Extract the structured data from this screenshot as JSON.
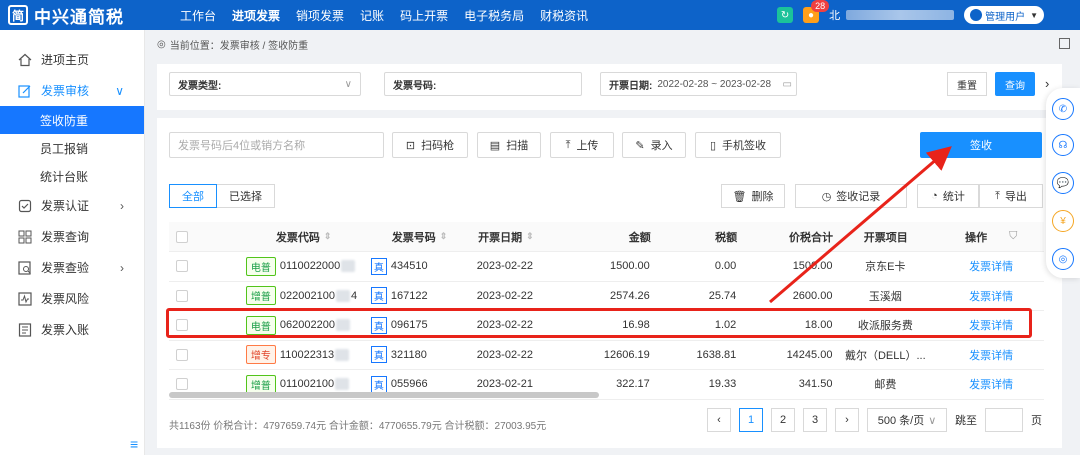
{
  "app": {
    "logo_mark": "简",
    "name": "中兴通简税"
  },
  "topnav": [
    {
      "label": "工作台"
    },
    {
      "label": "进项发票",
      "active": true
    },
    {
      "label": "销项发票"
    },
    {
      "label": "记账"
    },
    {
      "label": "码上开票"
    },
    {
      "label": "电子税务局"
    },
    {
      "label": "财税资讯"
    }
  ],
  "topbar": {
    "notif_count": "28",
    "city": "北",
    "user": "管理用户"
  },
  "sidebar": {
    "items": [
      {
        "label": "进项主页",
        "icon": "home-icon"
      },
      {
        "label": "发票审核",
        "icon": "edit-icon",
        "expanded": true
      },
      {
        "label": "签收防重",
        "sub": true,
        "active": true
      },
      {
        "label": "员工报销",
        "sub": true
      },
      {
        "label": "统计台账",
        "sub": true
      },
      {
        "label": "发票认证",
        "icon": "verify-icon",
        "arrow": true
      },
      {
        "label": "发票查询",
        "icon": "grid-icon"
      },
      {
        "label": "发票查验",
        "icon": "inspect-icon",
        "arrow": true
      },
      {
        "label": "发票风险",
        "icon": "risk-icon"
      },
      {
        "label": "发票入账",
        "icon": "ledger-icon"
      }
    ]
  },
  "breadcrumb": "当前位置：发票审核 / 签收防重",
  "filters": {
    "type_label": "发票类型:",
    "number_label": "发票号码:",
    "date_label": "开票日期:",
    "date_value": "2022-02-28 ~ 2023-02-28",
    "reset": "重置",
    "query": "查询",
    "more": "›"
  },
  "toolbar": {
    "search_placeholder": "发票号码后4位或销方名称",
    "scan_gun": "扫码枪",
    "scan": "扫描",
    "upload": "上传",
    "entry": "录入",
    "mobile_sign": "手机签收",
    "sign": "签收"
  },
  "segments": {
    "all": "全部",
    "selected": "已选择"
  },
  "actions": {
    "delete": "删除",
    "sign_record": "签收记录",
    "stats": "统计",
    "export": "导出"
  },
  "table": {
    "headers": {
      "code": "发票代码",
      "number": "发票号码",
      "date": "开票日期",
      "amount": "金额",
      "tax": "税额",
      "total": "价税合计",
      "item": "开票项目",
      "op": "操作"
    },
    "rows": [
      {
        "tag": "电普",
        "tag_color": "green",
        "code": "0110022000",
        "code_tail": "",
        "num": "434510",
        "date": "2023-02-22",
        "amount": "1500.00",
        "tax": "0.00",
        "total": "1500.00",
        "item": "京东E卡",
        "op": "发票详情"
      },
      {
        "tag": "增普",
        "tag_color": "green",
        "code": "022002100",
        "code_tail": "4",
        "num": "167122",
        "date": "2023-02-22",
        "amount": "2574.26",
        "tax": "25.74",
        "total": "2600.00",
        "item": "玉溪烟",
        "op": "发票详情"
      },
      {
        "tag": "电普",
        "tag_color": "green",
        "code": "062002200",
        "code_tail": "",
        "num": "096175",
        "date": "2023-02-22",
        "amount": "16.98",
        "tax": "1.02",
        "total": "18.00",
        "item": "收派服务费",
        "op": "发票详情"
      },
      {
        "tag": "增专",
        "tag_color": "red",
        "code": "110022313",
        "code_tail": "",
        "num": "321180",
        "date": "2023-02-22",
        "amount": "12606.19",
        "tax": "1638.81",
        "total": "14245.00",
        "item": "戴尔（DELL）...",
        "op": "发票详情"
      },
      {
        "tag": "增普",
        "tag_color": "green",
        "code": "011002100",
        "code_tail": "",
        "num": "055966",
        "date": "2023-02-21",
        "amount": "322.17",
        "tax": "19.33",
        "total": "341.50",
        "item": "邮费",
        "op": "发票详情"
      }
    ],
    "type_tag": "真"
  },
  "footer": {
    "summary": "共1163份 价税合计：4797659.74元 合计金额：4770655.79元 合计税额：27003.95元",
    "pages": [
      "1",
      "2",
      "3"
    ],
    "page_size": "500 条/页",
    "jump": "跳至",
    "page_unit": "页"
  },
  "colors": {
    "brand": "#0d63c9",
    "accent": "#1890ff",
    "highlight": "#e8231a"
  }
}
